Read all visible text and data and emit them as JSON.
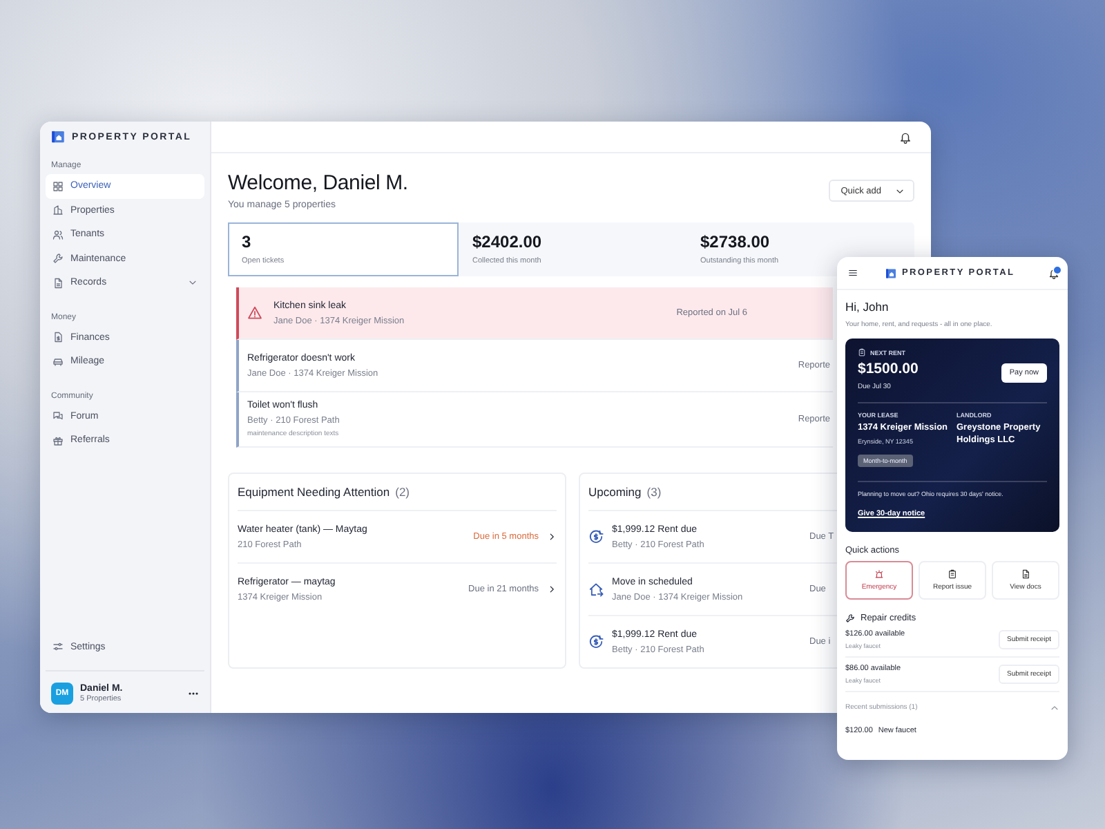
{
  "desktop": {
    "brand": "PROPERTY PORTAL",
    "nav_sections": [
      {
        "heading": "Manage",
        "items": [
          {
            "label": "Overview",
            "kind": "link",
            "selected": true
          },
          {
            "label": "Properties",
            "kind": "link",
            "selected": false
          },
          {
            "label": "Tenants",
            "kind": "link",
            "selected": false
          },
          {
            "label": "Maintenance",
            "kind": "link",
            "selected": false
          },
          {
            "label": "Records",
            "kind": "group",
            "selected": false
          }
        ]
      },
      {
        "heading": "Money",
        "items": [
          {
            "label": "Finances",
            "kind": "link",
            "selected": false
          },
          {
            "label": "Mileage",
            "kind": "link",
            "selected": false
          }
        ]
      },
      {
        "heading": "Community",
        "items": [
          {
            "label": "Forum",
            "kind": "link",
            "selected": false
          },
          {
            "label": "Referrals",
            "kind": "link",
            "selected": false
          }
        ]
      }
    ],
    "settings": "Settings",
    "user": {
      "initials": "DM",
      "name": "Daniel M.",
      "subtitle": "5 Properties"
    },
    "welcome": "Welcome, Daniel M.",
    "subtitle": "You manage 5 properties",
    "quick_add": "Quick add",
    "stats": [
      {
        "value": "3",
        "label": "Open tickets",
        "selected": true
      },
      {
        "value": "$2402.00",
        "label": "Collected this month",
        "selected": false
      },
      {
        "value": "$2738.00",
        "label": "Outstanding this month",
        "selected": false
      }
    ],
    "tickets": [
      {
        "title": "Kitchen sink leak",
        "meta": "Jane Doe · 1374 Kreiger Mission",
        "reported": "Reported on Jul 6",
        "urgent": true
      },
      {
        "title": "Refrigerator doesn't work",
        "meta": "Jane Doe · 1374 Kreiger Mission",
        "reported": "Reporte",
        "urgent": false
      },
      {
        "title": "Toilet won't flush",
        "meta": "Betty · 210 Forest Path",
        "note": "maintenance description texts",
        "reported": "Reporte",
        "urgent": false
      }
    ],
    "equipment": {
      "title": "Equipment Needing Attention",
      "count": "(2)",
      "items": [
        {
          "name": "Water heater (tank) — Maytag",
          "address": "210 Forest Path",
          "due": "Due in 5 months",
          "warning": true
        },
        {
          "name": "Refrigerator — maytag",
          "address": "1374 Kreiger Mission",
          "due": "Due in 21 months",
          "warning": false
        }
      ]
    },
    "upcoming": {
      "title": "Upcoming",
      "count": "(3)",
      "items": [
        {
          "kind": "rent",
          "title": "$1,999.12 Rent due",
          "meta": "Betty · 210 Forest Path",
          "due": "Due T"
        },
        {
          "kind": "move_in",
          "title": "Move in scheduled",
          "meta": "Jane Doe · 1374 Kreiger Mission",
          "due": "Due"
        },
        {
          "kind": "rent",
          "title": "$1,999.12 Rent due",
          "meta": "Betty · 210 Forest Path",
          "due": "Due i"
        }
      ]
    }
  },
  "mobile": {
    "brand": "PROPERTY PORTAL",
    "greeting": "Hi, John",
    "tagline": "Your home, rent, and requests - all in one place.",
    "rent_card": {
      "label": "NEXT RENT",
      "amount": "$1500.00",
      "due": "Due Jul 30",
      "pay_button": "Pay now",
      "lease_label": "YOUR LEASE",
      "lease_address": "1374 Kreiger Mission",
      "lease_city": "Erynside, NY 12345",
      "lease_term": "Month-to-month",
      "landlord_label": "LANDLORD",
      "landlord": "Greystone Property Holdings LLC",
      "notice": "Planning to move out? Ohio requires 30 days' notice.",
      "notice_link": "Give 30-day notice"
    },
    "quick_actions_title": "Quick actions",
    "quick_actions": [
      {
        "label": "Emergency",
        "kind": "emergency"
      },
      {
        "label": "Report issue",
        "kind": "report"
      },
      {
        "label": "View docs",
        "kind": "docs"
      }
    ],
    "repair_credits": {
      "title": "Repair credits",
      "items": [
        {
          "amount": "$126.00 available",
          "item": "Leaky faucet",
          "button": "Submit receipt"
        },
        {
          "amount": "$86.00 available",
          "item": "Leaky faucet",
          "button": "Submit receipt"
        }
      ]
    },
    "recent": {
      "label": "Recent submissions (1)",
      "expanded": true,
      "items": [
        {
          "amount": "$120.00",
          "item": "New faucet"
        }
      ]
    }
  }
}
